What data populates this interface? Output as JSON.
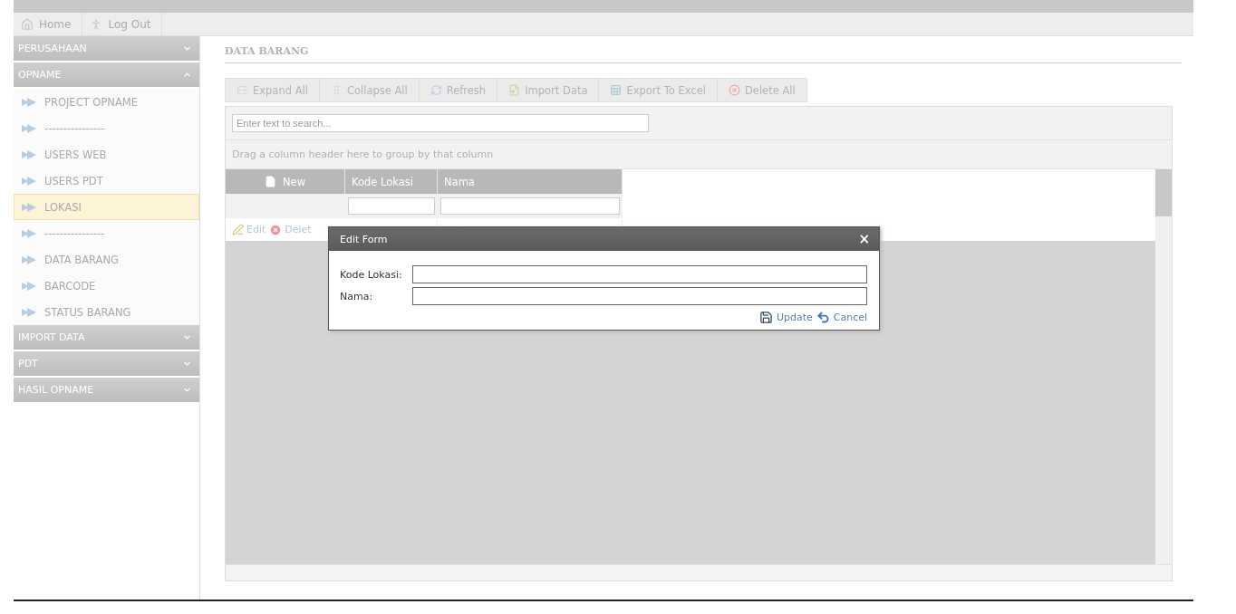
{
  "top_nav": [
    {
      "label": "Home"
    },
    {
      "label": "Log Out"
    }
  ],
  "sidebar": [
    {
      "label": "PERUSAHAAN",
      "expanded": false
    },
    {
      "label": "OPNAME",
      "expanded": true,
      "items": [
        {
          "label": "PROJECT OPNAME",
          "selected": false
        },
        {
          "label": "----------------",
          "selected": false
        },
        {
          "label": "USERS WEB",
          "selected": false
        },
        {
          "label": "USERS PDT",
          "selected": false
        },
        {
          "label": "LOKASI",
          "selected": true
        },
        {
          "label": "----------------",
          "selected": false
        },
        {
          "label": "DATA BARANG",
          "selected": false
        },
        {
          "label": "BARCODE",
          "selected": false
        },
        {
          "label": "STATUS BARANG",
          "selected": false
        }
      ]
    },
    {
      "label": "IMPORT DATA",
      "expanded": false
    },
    {
      "label": "PDT",
      "expanded": false
    },
    {
      "label": "HASIL OPNAME",
      "expanded": false
    }
  ],
  "page_title": "DATA BARANG",
  "toolbar": [
    "Expand All",
    "Collapse All",
    "Refresh",
    "Import Data",
    "Export To Excel",
    "Delete All"
  ],
  "grid": {
    "search": {
      "placeholder": "Enter text to search..."
    },
    "group_panel": "Drag a column header here to group by that column",
    "columns": [
      "New",
      "Kode Lokasi",
      "Nama"
    ],
    "rows": [
      {
        "commands": [
          "Edit",
          "Delet"
        ]
      }
    ]
  },
  "dialog": {
    "title": "Edit Form",
    "close": "×",
    "fields": [
      {
        "label": "Kode Lokasi:"
      },
      {
        "label": "Nama:"
      }
    ],
    "buttons": [
      "Update",
      "Cancel"
    ]
  }
}
